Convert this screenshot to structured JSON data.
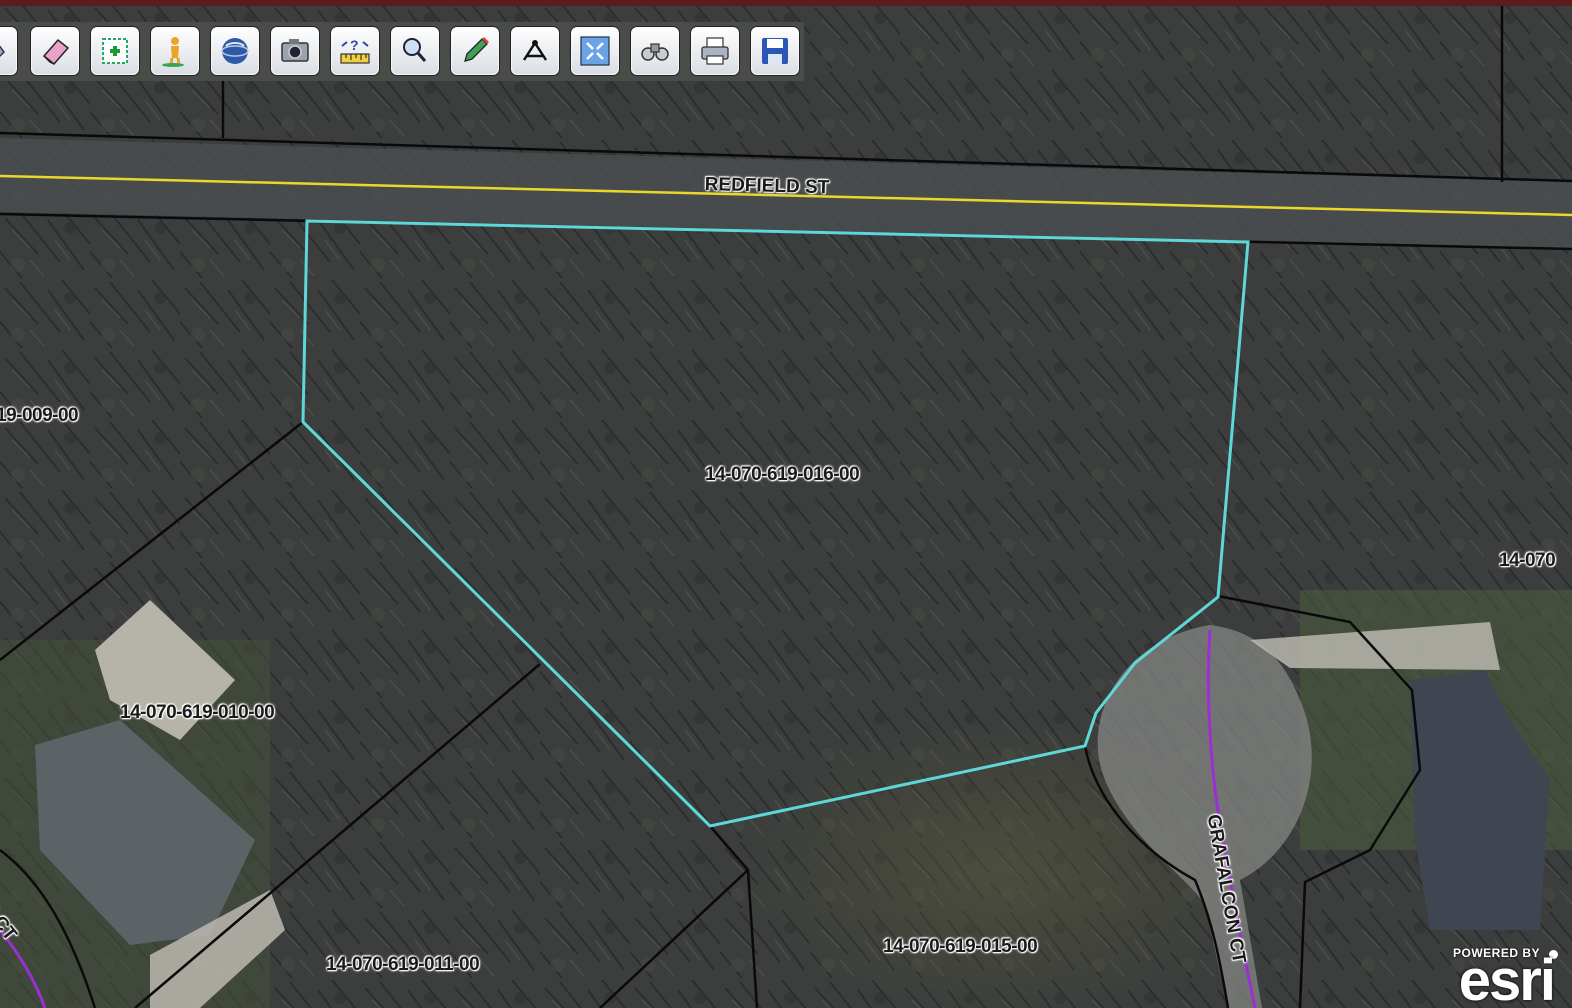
{
  "map": {
    "colors": {
      "top_bar": "#5c1b1d",
      "parcel_line": "#0a0a0a",
      "selected_parcel": "#5fd6d8",
      "road_centerline": "#e8d82a",
      "private_road_line": "#9b2fd1",
      "imagery_base": "#3b3e3c"
    },
    "streets": [
      {
        "id": "redfield",
        "label": "REDFIELD ST"
      },
      {
        "id": "grafalcon",
        "label": "GRAFALCON CT"
      },
      {
        "id": "partial_ct",
        "label": "E CT"
      }
    ],
    "parcels": [
      {
        "id": "p009",
        "label": "19-009-00",
        "selected": false
      },
      {
        "id": "p016",
        "label": "14-070-619-016-00",
        "selected": true
      },
      {
        "id": "p010",
        "label": "14-070-619-010-00",
        "selected": false
      },
      {
        "id": "p011",
        "label": "14-070-619-011-00",
        "selected": false
      },
      {
        "id": "p015",
        "label": "14-070-619-015-00",
        "selected": false
      },
      {
        "id": "p_right",
        "label": "14-070",
        "selected": false
      }
    ],
    "attribution": {
      "powered_by": "POWERED BY",
      "brand": "esri"
    }
  },
  "toolbar": {
    "tools": [
      {
        "id": "pan",
        "icon": "pan-hand-icon"
      },
      {
        "id": "erase",
        "icon": "eraser-icon"
      },
      {
        "id": "select-parcels",
        "icon": "select-parcels-icon"
      },
      {
        "id": "street-view",
        "icon": "street-view-person-icon"
      },
      {
        "id": "globe",
        "icon": "globe-icon"
      },
      {
        "id": "photo",
        "icon": "camera-icon"
      },
      {
        "id": "measure",
        "icon": "measure-ruler-icon"
      },
      {
        "id": "xy-search",
        "icon": "xy-search-icon"
      },
      {
        "id": "draw",
        "icon": "pencil-icon"
      },
      {
        "id": "survey",
        "icon": "survey-point-icon"
      },
      {
        "id": "full-extent",
        "icon": "full-extent-icon"
      },
      {
        "id": "binoculars",
        "icon": "binoculars-icon"
      },
      {
        "id": "print",
        "icon": "printer-icon"
      },
      {
        "id": "save",
        "icon": "save-disk-icon"
      }
    ]
  }
}
